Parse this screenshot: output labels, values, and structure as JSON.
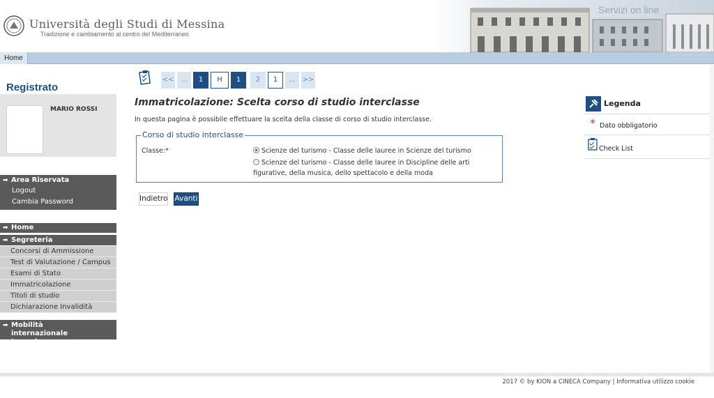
{
  "header": {
    "university_name": "Università degli Studi di Messina",
    "tagline": "Tradizione e cambiamento al centro del Mediterraneo",
    "services_label": "Servizi on line"
  },
  "menubar": {
    "home_label": "Home"
  },
  "sidebar": {
    "title": "Registrato",
    "user_name": "MARIO ROSSI",
    "area_riservata": {
      "label": "Area Riservata",
      "items": [
        "Logout",
        "Cambia Password"
      ]
    },
    "home_label": "Home",
    "segreteria": {
      "label": "Segreteria",
      "items": [
        "Concorsi di Ammissione",
        "Test di Valutazione / Campus",
        "Esami di Stato",
        "Immatricolazione",
        "Titoli di studio",
        "Dichiarazione Invalidità"
      ]
    },
    "mobilita_label": "Mobilità internazionale Incoming"
  },
  "pager": {
    "items": [
      "<<",
      "...",
      "1",
      "H",
      "1",
      "2",
      "1",
      "...",
      ">>"
    ]
  },
  "main": {
    "title": "Immatricolazione: Scelta corso di studio interclasse",
    "intro": "In questa pagina è possibile effettuare la scelta della classe di corso di studio interclasse.",
    "fieldset_legend": "Corso di studio interclasse",
    "classe_label": "Classe:*",
    "options": [
      "Scienze del turismo - Classe delle lauree in Scienze del turismo",
      "Scienze del turismo - Classe delle lauree in Discipline delle arti figurative, della musica, dello spettacolo e della moda"
    ],
    "selected_option_index": 0,
    "back_label": "Indietro",
    "next_label": "Avanti"
  },
  "legend": {
    "title": "Legenda",
    "required_star": "*",
    "required_label": "Dato obbligatorio",
    "checklist_label": "Check List"
  },
  "footer": {
    "text": "2017 © by KION a CINECA Company | Informativa utilizzo cookie"
  },
  "colors": {
    "brand_blue": "#1f4f82",
    "menubar": "#b9cde0",
    "sidebar_dark": "#5a5a5a",
    "sidebar_light": "#cfcfcf",
    "required_red": "#c0392b"
  }
}
